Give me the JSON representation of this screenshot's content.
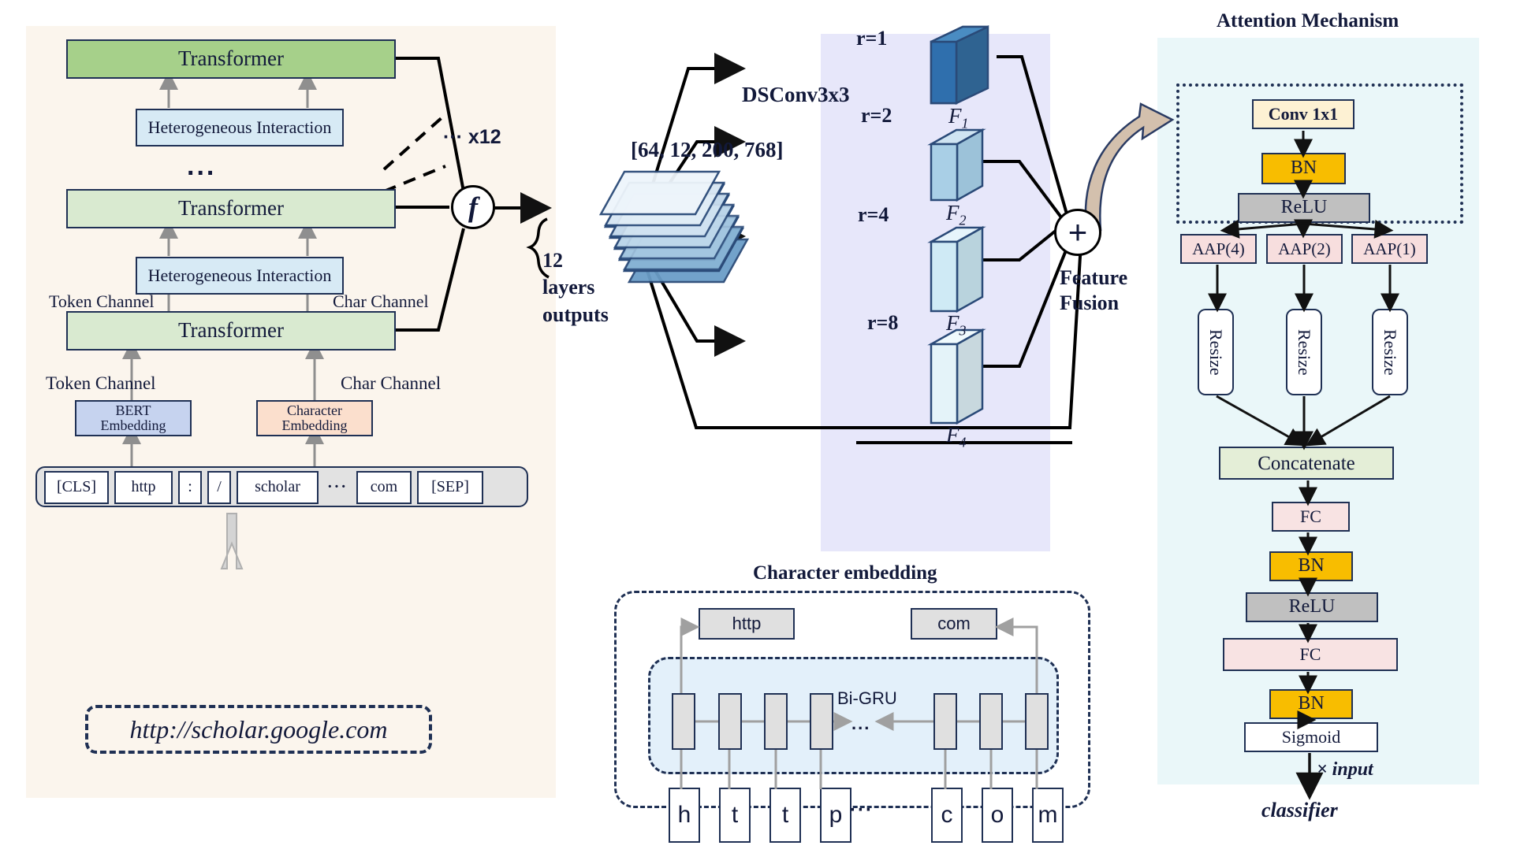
{
  "left_panel": {
    "transformer_top": "Transformer",
    "het_top": "Heterogeneous Interaction",
    "ellipsis": "...",
    "x12": "··· x12",
    "transformer_mid": "Transformer",
    "het_mid": "Heterogeneous Interaction",
    "transformer_bottom": "Transformer",
    "token_channel_upper": "Token Channel",
    "char_channel_upper": "Char Channel",
    "token_channel_lower": "Token Channel",
    "char_channel_lower": "Char Channel",
    "bert_embedding": "BERT\nEmbedding",
    "bert_embedding_line1": "BERT",
    "bert_embedding_line2": "Embedding",
    "character_embedding_line1": "Character",
    "character_embedding_line2": "Embedding",
    "tokens": [
      "[CLS]",
      "http",
      ":",
      "/",
      "scholar",
      "···",
      "com",
      "[SEP]"
    ],
    "url_input": "http://scholar.google.com"
  },
  "middle": {
    "f_symbol": "f",
    "tensor_shape": "[64, 12, 200, 768]",
    "layers_note_line1": "12",
    "layers_note_line2": "layers",
    "layers_note_line3": "outputs"
  },
  "dsconv": {
    "title": "DSConv3x3",
    "rates": [
      "r=1",
      "r=2",
      "r=4",
      "r=8"
    ],
    "feature_labels": [
      "F₁",
      "F₂",
      "F₃",
      "F₄"
    ],
    "feature_label_base": [
      "F",
      "F",
      "F",
      "F"
    ],
    "feature_label_sub": [
      "1",
      "2",
      "3",
      "4"
    ],
    "fusion_symbol": "+",
    "fusion_label_line1": "Feature",
    "fusion_label_line2": "Fusion"
  },
  "attention": {
    "title": "Attention Mechanism",
    "conv": "Conv 1x1",
    "bn_top": "BN",
    "relu_top": "ReLU",
    "aap": [
      "AAP(4)",
      "AAP(2)",
      "AAP(1)"
    ],
    "resize": [
      "Resize",
      "Resize",
      "Resize"
    ],
    "concatenate": "Concatenate",
    "fc_1": "FC",
    "bn_mid": "BN",
    "relu_mid": "ReLU",
    "fc_2": "FC",
    "bn_bottom": "BN",
    "sigmoid": "Sigmoid",
    "times_input": "× input",
    "classifier": "classifier"
  },
  "char_embedding": {
    "title": "Character embedding",
    "word_left": "http",
    "word_right": "com",
    "gru_label": "Bi-GRU",
    "gru_ellipsis": "...",
    "chars_left": [
      "h",
      "t",
      "t",
      "p"
    ],
    "chars_ellipsis": "···",
    "chars_right": [
      "c",
      "o",
      "m"
    ]
  },
  "colors": {
    "panel_left_bg": "#fbf5ed",
    "panel_dsconv_bg": "#e7e7fa",
    "panel_attention_bg": "#eaf7f9",
    "stroke": "#1f3054",
    "transformer_dark": "#a6d08a",
    "transformer_light": "#d9ead0",
    "interaction": "#d7eaf5",
    "bert": "#c6d3ef",
    "character": "#fbdfcd",
    "bn": "#f8bd00",
    "relu": "#c0c0c0",
    "aap": "#f7dede",
    "concat": "#e4eed7",
    "conv": "#fdf1d3",
    "f1": "#2f6fad",
    "f2": "#a9cfe6",
    "f3": "#cfeaf5",
    "f4": "#e4f3f9"
  }
}
